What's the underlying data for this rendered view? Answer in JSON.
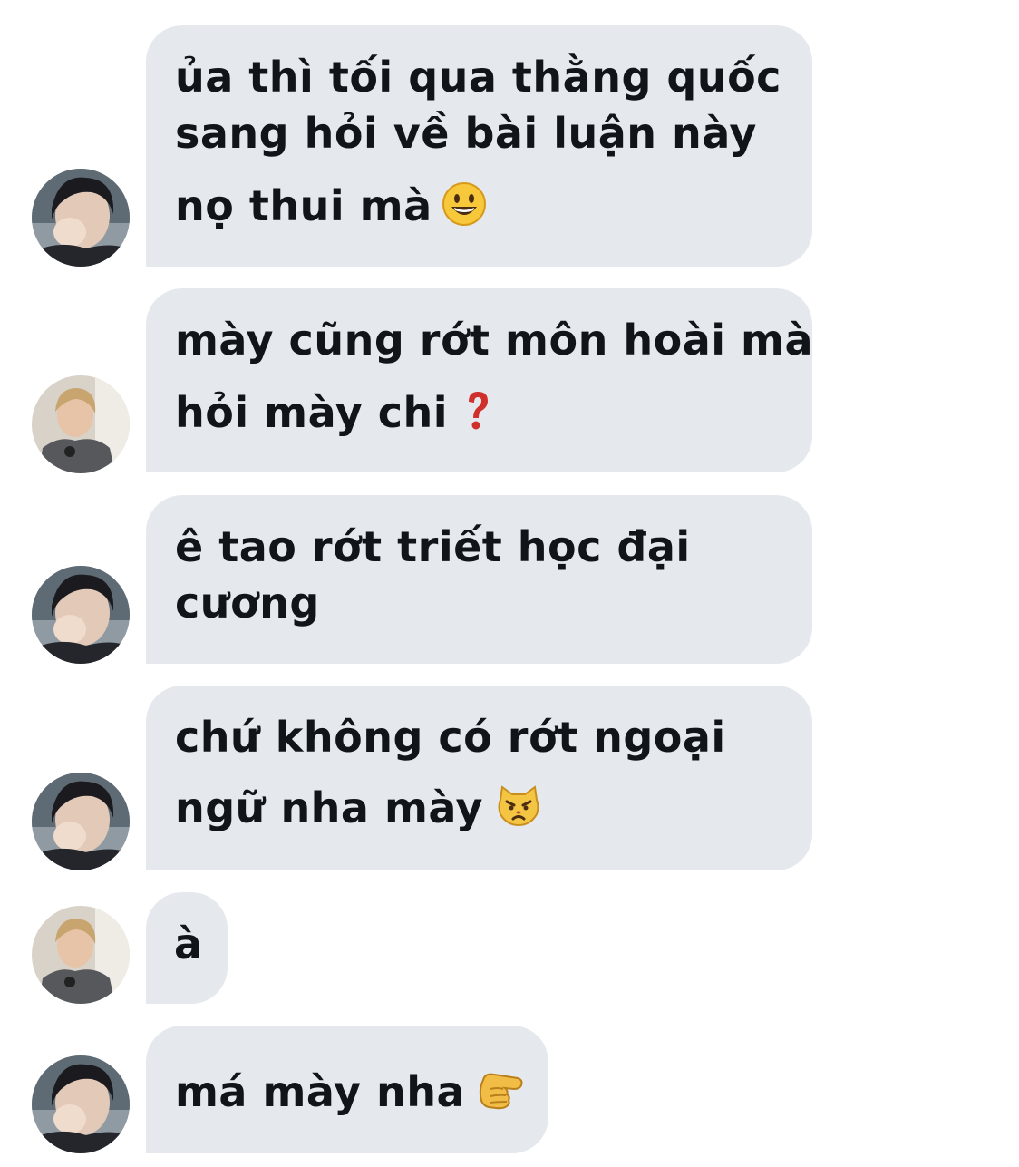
{
  "conversation": {
    "messages": [
      {
        "sender": "dark",
        "lines": [
          "ủa thì tối qua thằng quốc",
          "sang hỏi về bài luận này",
          "nọ thui mà"
        ],
        "emoji": "smiling-face-emoji"
      },
      {
        "sender": "blond",
        "lines": [
          "mày cũng rớt môn hoài mà",
          "hỏi mày chi"
        ],
        "emoji": "red-question-mark-emoji"
      },
      {
        "sender": "dark",
        "lines": [
          "ê tao rớt triết học đại",
          "cương"
        ],
        "emoji": ""
      },
      {
        "sender": "dark",
        "lines": [
          "chứ không có rớt ngoại",
          "ngữ nha mày"
        ],
        "emoji": "pouting-cat-emoji"
      },
      {
        "sender": "blond",
        "lines": [
          "à"
        ],
        "emoji": ""
      },
      {
        "sender": "dark",
        "lines": [
          "má mày nha"
        ],
        "emoji": "pointing-finger-emoji"
      }
    ]
  },
  "colors": {
    "bubble": "#e5e9ee",
    "text": "#111418",
    "question_mark": "#d0302b"
  }
}
